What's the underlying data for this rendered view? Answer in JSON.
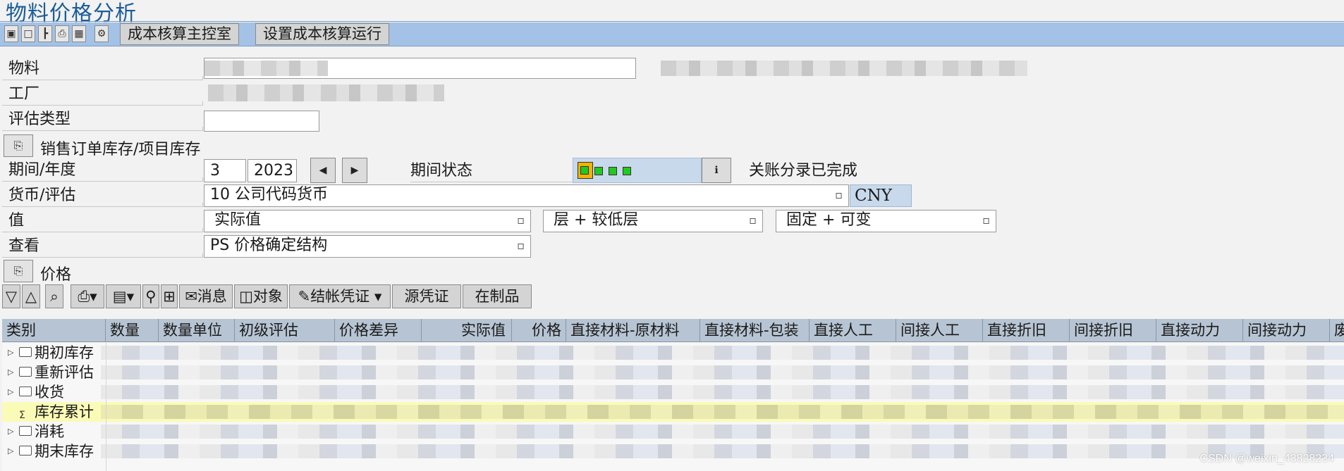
{
  "title": "物料价格分析",
  "toolbar": {
    "icons": [
      "new-icon",
      "display-icon",
      "hierarchy-icon",
      "print-icon",
      "table-icon",
      "settings-icon"
    ],
    "buttons": [
      "成本核算主控室",
      "设置成本核算运行"
    ]
  },
  "form": {
    "material_label": "物料",
    "plant_label": "工厂",
    "valuation_type_label": "评估类型",
    "sales_order_stock_label": "销售订单库存/项目库存",
    "period_year_label": "期间/年度",
    "period_value": "3",
    "year_value": "2023",
    "period_status_label": "期间状态",
    "closing_status_text": "关账分录已完成",
    "currency_valuation_label": "货币/评估",
    "currency_valuation_value": "10 公司代码货币",
    "currency_code": "CNY",
    "value_label": "值",
    "value_option_1": "实际值",
    "value_option_2": "层 + 较低层",
    "value_option_3": "固定 + 可变",
    "view_label": "查看",
    "view_value": "PS 价格确定结构",
    "price_section_label": "价格"
  },
  "grid_toolbar": {
    "message_label": "消息",
    "object_label": "对象",
    "settlement_label": "结帐凭证",
    "source_doc_label": "源凭证",
    "wip_label": "在制品"
  },
  "table": {
    "headers": [
      "类别",
      "数量",
      "数量单位",
      "初级评估",
      "价格差异",
      "实际值",
      "价格",
      "直接材料-原材料",
      "直接材料-包装",
      "直接人工",
      "间接人工",
      "直接折旧",
      "间接折旧",
      "直接动力",
      "间接动力",
      "废"
    ],
    "rows": [
      {
        "label": "期初库存",
        "type": "folder"
      },
      {
        "label": "重新评估",
        "type": "folder"
      },
      {
        "label": "收货",
        "type": "folder"
      },
      {
        "label": "库存累计",
        "type": "sum"
      },
      {
        "label": "消耗",
        "type": "folder"
      },
      {
        "label": "期末库存",
        "type": "folder"
      }
    ]
  },
  "watermark": "CSDN @weixin_43828234",
  "colors": {
    "title": "#1c5d99",
    "toolbar_bg": "#a3c2e6",
    "header_bg": "#b7c4d3",
    "highlight_row": "#fbfbb8",
    "status_light": "#22c91e",
    "status_light_first": "#f0b400"
  }
}
